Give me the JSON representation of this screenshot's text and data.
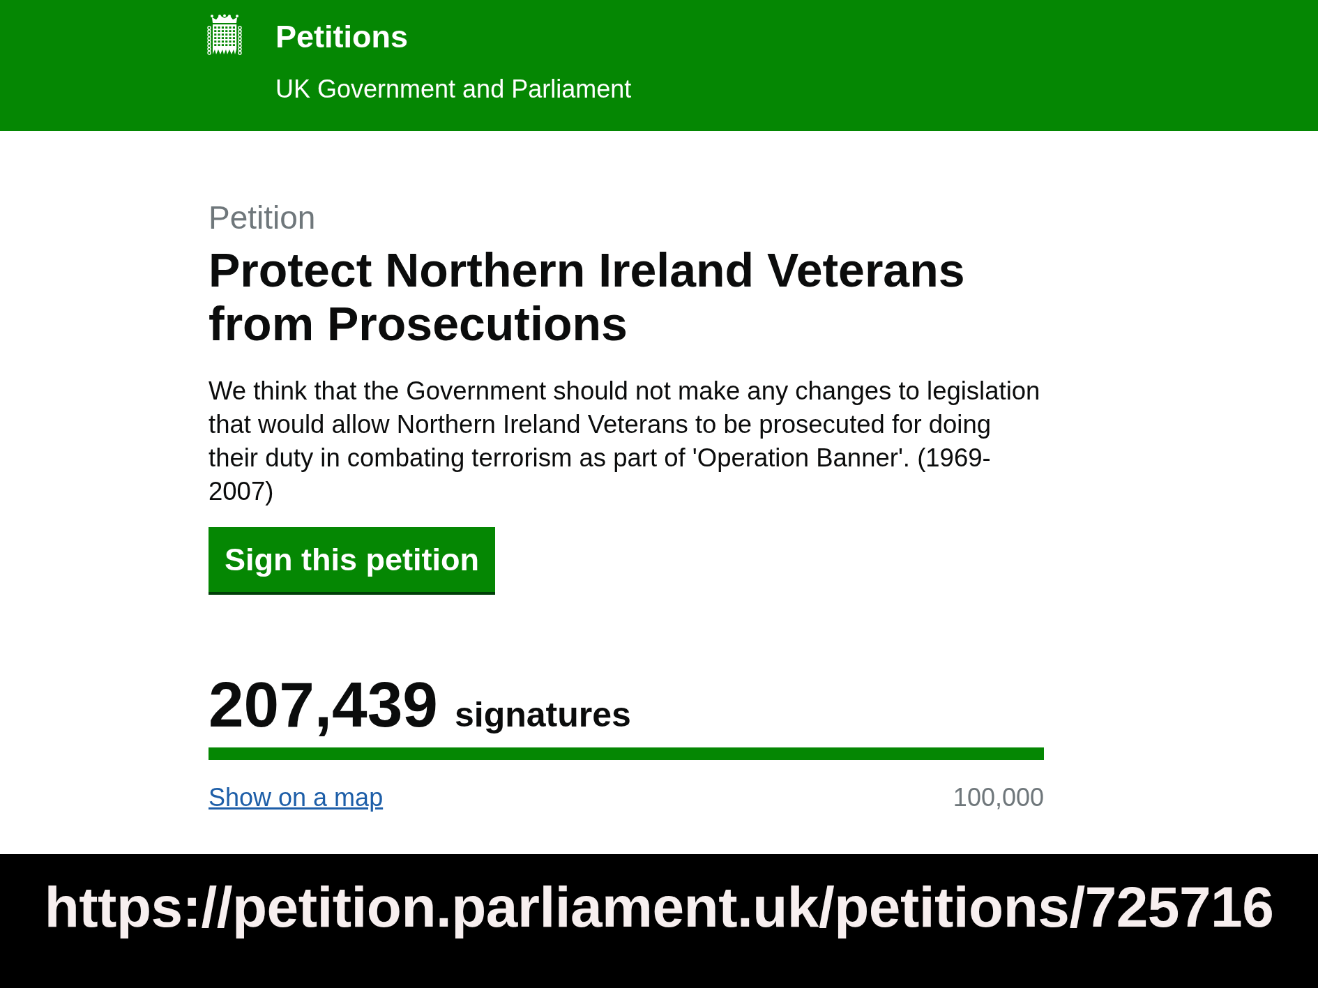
{
  "header": {
    "title": "Petitions",
    "subtitle": "UK Government and Parliament"
  },
  "petition": {
    "label": "Petition",
    "title": "Protect Northern Ireland Veterans from Prosecutions",
    "description": "We think that the Government should not make any changes to legislation that would allow Northern Ireland Veterans to be prosecuted for doing their duty in combating terrorism as part of 'Operation Banner'. (1969-2007)",
    "sign_button": "Sign this petition"
  },
  "signatures": {
    "count": "207,439",
    "label": "signatures",
    "level": 1,
    "map_link": "Show on a map",
    "target": "100,000"
  },
  "banner": {
    "url": "https://petition.parliament.uk/petitions/725716"
  }
}
